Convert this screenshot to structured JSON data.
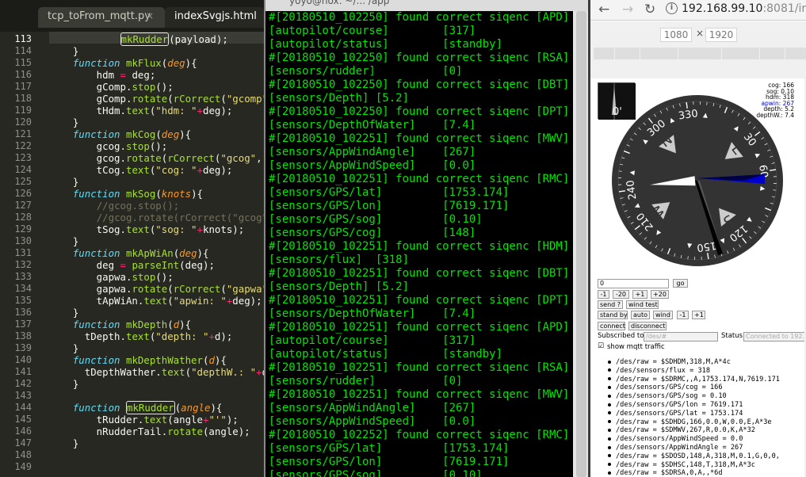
{
  "editor": {
    "tabs": [
      {
        "label": "tcp_toFrom_mqtt.py",
        "close": "×"
      },
      {
        "label": "indexSvgjs.html"
      }
    ],
    "lines": [
      {
        "n": "113",
        "html": "            <span class=\"fn hl\">mkRudder</span>(payload);"
      },
      {
        "n": "114",
        "html": "    }"
      },
      {
        "n": "115",
        "html": "    <span class=\"kw\">function</span> <span class=\"fn\">mkFlux</span>(<span class=\"pa\">deg</span>){"
      },
      {
        "n": "116",
        "html": "        hdm <span class=\"op\">=</span> deg;"
      },
      {
        "n": "117",
        "html": "        gComp.<span class=\"fn\">stop</span>();"
      },
      {
        "n": "118",
        "html": "        gComp.<span class=\"fn\">rotate</span>(<span class=\"fn\">rCorrect</span>(<span class=\"st\">\"gcomp\"</span>,"
      },
      {
        "n": "119",
        "html": "        tHdm.<span class=\"fn\">text</span>(<span class=\"st\">\"hdm: \"</span><span class=\"op\">+</span>deg);"
      },
      {
        "n": "120",
        "html": "    }"
      },
      {
        "n": "121",
        "html": "    <span class=\"kw\">function</span> <span class=\"fn\">mkCog</span>(<span class=\"pa\">deg</span>){"
      },
      {
        "n": "122",
        "html": "        gcog.<span class=\"fn\">stop</span>();"
      },
      {
        "n": "123",
        "html": "        gcog.<span class=\"fn\">rotate</span>(<span class=\"fn\">rCorrect</span>(<span class=\"st\">\"gcog\"</span>, deg"
      },
      {
        "n": "124",
        "html": "        tCog.<span class=\"fn\">text</span>(<span class=\"st\">\"cog: \"</span><span class=\"op\">+</span>deg);"
      },
      {
        "n": "125",
        "html": "    }"
      },
      {
        "n": "126",
        "html": "    <span class=\"kw\">function</span> <span class=\"fn\">mkSog</span>(<span class=\"pa\">knots</span>){"
      },
      {
        "n": "127",
        "html": "        <span class=\"cm\">//gcog.stop();</span>"
      },
      {
        "n": "128",
        "html": "        <span class=\"cm\">//gcog.rotate(rCorrect(\"gcog\", d</span>"
      },
      {
        "n": "129",
        "html": "        tSog.<span class=\"fn\">text</span>(<span class=\"st\">\"sog: \"</span><span class=\"op\">+</span>knots);"
      },
      {
        "n": "130",
        "html": "    }"
      },
      {
        "n": "131",
        "html": "    <span class=\"kw\">function</span> <span class=\"fn\">mkApWiAn</span>(<span class=\"pa\">deg</span>){"
      },
      {
        "n": "132",
        "html": "        deg <span class=\"op\">=</span> <span class=\"fn\">parseInt</span>(deg);"
      },
      {
        "n": "133",
        "html": "        gapwa.<span class=\"fn\">stop</span>();"
      },
      {
        "n": "134",
        "html": "        gapwa.<span class=\"fn\">rotate</span>(<span class=\"fn\">rCorrect</span>(<span class=\"st\">\"gapwa\"</span>, <span class=\"pa\">3</span>"
      },
      {
        "n": "135",
        "html": "        tApWiAn.<span class=\"fn\">text</span>(<span class=\"st\">\"apwin: \"</span><span class=\"op\">+</span>deg);"
      },
      {
        "n": "136",
        "html": "    }"
      },
      {
        "n": "137",
        "html": "    <span class=\"kw\">function</span> <span class=\"fn\">mkDepth</span>(<span class=\"pa\">d</span>){"
      },
      {
        "n": "138",
        "html": "      tDepth.<span class=\"fn\">text</span>(<span class=\"st\">\"depth: \"</span><span class=\"op\">+</span>d);"
      },
      {
        "n": "139",
        "html": "    }"
      },
      {
        "n": "140",
        "html": "    <span class=\"kw\">function</span> <span class=\"fn\">mkDepthWather</span>(<span class=\"pa\">d</span>){"
      },
      {
        "n": "141",
        "html": "      tDepthWather.<span class=\"fn\">text</span>(<span class=\"st\">\"depthW.: \"</span><span class=\"op\">+</span>d)"
      },
      {
        "n": "142",
        "html": "    }"
      },
      {
        "n": "143",
        "html": ""
      },
      {
        "n": "144",
        "html": "    <span class=\"kw\">function</span> <span class=\"fn hl\">mkRudder</span>(<span class=\"pa\">angle</span>){"
      },
      {
        "n": "145",
        "html": "        tRudder.<span class=\"fn\">text</span>(angle<span class=\"op\">+</span><span class=\"st\">\"'\"</span>);"
      },
      {
        "n": "146",
        "html": "        nRudderTail.<span class=\"fn\">rotate</span>(angle);"
      },
      {
        "n": "147",
        "html": "    }"
      },
      {
        "n": "148",
        "html": ""
      },
      {
        "n": "149",
        "html": ""
      }
    ]
  },
  "terminal": {
    "title": "yoyo@nox: ~/... /app",
    "lines": [
      "#[20180510_102250] found correct siqenc [APD]",
      "[autopilot/course]        [317]",
      "[autopilot/status]        [standby]",
      "#[20180510_102250] found correct siqenc [RSA]",
      "[sensors/rudder]          [0]",
      "#[20180510_102250] found correct siqenc [DBT]",
      "[sensors/Depth] [5.2]",
      "#[20180510_102250] found correct siqenc [DPT]",
      "[sensors/DepthOfWater]    [7.4]",
      "#[20180510_102251] found correct siqenc [MWV]",
      "[sensors/AppWindAngle]    [267]",
      "[sensors/AppWindSpeed]    [0.0]",
      "#[20180510_102251] found correct siqenc [RMC]",
      "[sensors/GPS/lat]         [1753.174]",
      "[sensors/GPS/lon]         [7619.171]",
      "[sensors/GPS/sog]         [0.10]",
      "[sensors/GPS/cog]         [148]",
      "#[20180510_102251] found correct siqenc [HDM]",
      "[sensors/flux]  [318]",
      "#[20180510_102251] found correct siqenc [DBT]",
      "[sensors/Depth] [5.2]",
      "#[20180510_102251] found correct siqenc [DPT]",
      "[sensors/DepthOfWater]    [7.4]",
      "#[20180510_102251] found correct siqenc [APD]",
      "[autopilot/course]        [317]",
      "[autopilot/status]        [standby]",
      "#[20180510_102251] found correct siqenc [RSA]",
      "[sensors/rudder]          [0]",
      "#[20180510_102251] found correct siqenc [MWV]",
      "[sensors/AppWindAngle]    [267]",
      "[sensors/AppWindSpeed]    [0.0]",
      "#[20180510_102252] found correct siqenc [RMC]",
      "[sensors/GPS/lat]         [1753.174]",
      "[sensors/GPS/lon]         [7619.171]",
      "[sensors/GPS/sog]         [0.10]"
    ]
  },
  "browser": {
    "url_host": "192.168.99.10",
    "url_rest": ":8081/inde",
    "device_width": "1080",
    "device_height": "1920",
    "device_x": "×",
    "stats": {
      "cog": "cog: 166",
      "sog": "sog: 0.10",
      "hdm": "hdm: 318",
      "apwin": "apwin: 267",
      "depth": "depth: 5.2",
      "depthw": "depthW.: 7.4"
    },
    "mini_rudder": "0'",
    "compass_labels": [
      "330",
      "300",
      "240",
      "210",
      "150",
      "120",
      "60",
      "30"
    ],
    "compass_points": [
      "N",
      "E",
      "S",
      "W"
    ],
    "controls": {
      "course_value": "0",
      "go": "go",
      "m1": "-1",
      "m20": "-20",
      "p1": "+1",
      "p20": "+20",
      "send": "send ?",
      "wind_test": "wind test",
      "standby": "stand by",
      "auto": "auto",
      "wind": "wind",
      "m1b": "-1",
      "p1b": "+1",
      "connect": "connect",
      "disconnect": "disconnect",
      "subscribed_label": "Subscribed to",
      "subscribed_placeholder": "/des/#",
      "status_label": "Status:",
      "status_value": "Connected to 192.16",
      "show_traffic": "show mqtt traffic"
    },
    "traffic": [
      "/des/raw = $SDHDM,318,M,A*4c",
      "/des/sensors/flux = 318",
      "/des/raw = $SDRMC,,A,1753.174,N,7619.171",
      "/des/sensors/GPS/cog = 166",
      "/des/sensors/GPS/sog = 0.10",
      "/des/sensors/GPS/lon = 7619.171",
      "/des/sensors/GPS/lat = 1753.174",
      "/des/raw = $SDHDG,166,0.0,W,0.0,E,A*3e",
      "/des/raw = $SDMWV,267,R,0.0,K,A*32",
      "/des/sensors/AppWindSpeed = 0.0",
      "/des/sensors/AppWindAngle = 267",
      "/des/raw = $SDOSD,148,A,318,M,0.1,G,0,0,",
      "/des/raw = $SDHSC,148,T,318,M,A*3c",
      "/des/raw = $SDRSA,0,A,,*6d"
    ],
    "colors": {
      "apwin": "#0000cc",
      "needle_dark": "#111111",
      "accent_green": "#00e600"
    }
  }
}
